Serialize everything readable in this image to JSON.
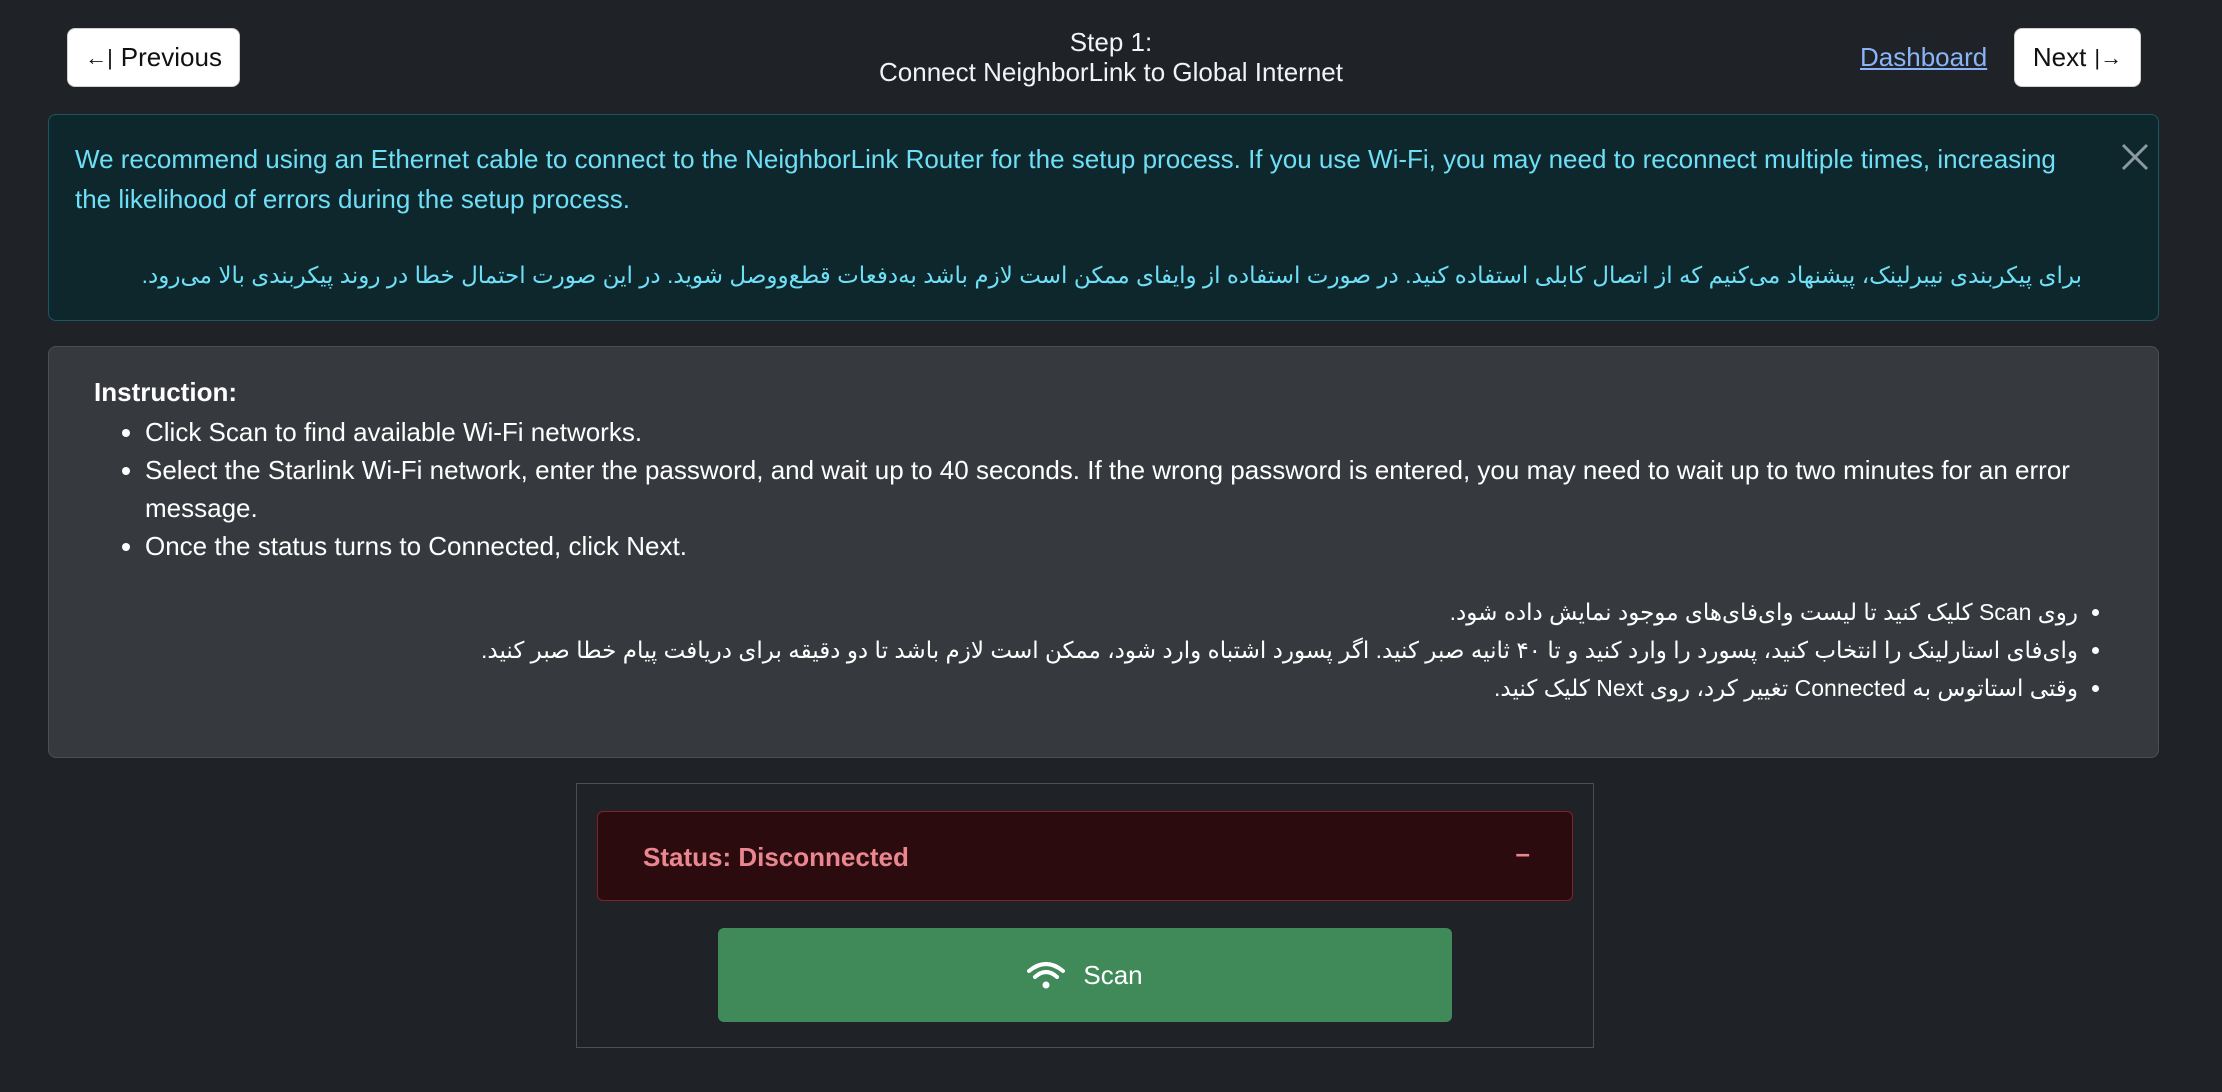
{
  "header": {
    "previous_glyph": "←|",
    "previous_label": "Previous",
    "step_line1": "Step 1:",
    "step_line2": "Connect NeighborLink to Global Internet",
    "dashboard_link": "Dashboard",
    "next_label": "Next",
    "next_glyph": "|→"
  },
  "alert": {
    "text_en": "We recommend using an Ethernet cable to connect to the NeighborLink Router for the setup process. If you use Wi-Fi, you may need to reconnect multiple times, increasing the likelihood of errors during the setup process.",
    "text_fa": "برای پیکربندی نیبرلینک، پیشنهاد می‌کنیم که از اتصال کابلی استفاده کنید. در صورت استفاده از وایفای ممکن است لازم باشد به‌دفعات قطع‌ووصل شوید. در این صورت احتمال خطا در روند پیکربندی بالا می‌رود.",
    "close_icon": "close-icon",
    "color": "#6edff6"
  },
  "instructions": {
    "title": "Instruction:",
    "items_en": [
      "Click Scan to find available Wi-Fi networks.",
      "Select the Starlink Wi-Fi network, enter the password, and wait up to 40 seconds. If the wrong password is entered, you may need to wait up to two minutes for an error message.",
      "Once the status turns to Connected, click Next."
    ],
    "items_fa": [
      "روی Scan کلیک کنید تا لیست وای‌فای‌های موجود نمایش داده شود.",
      "وای‌فای استارلینک را انتخاب کنید، پسورد را وارد کنید و تا ۴۰ ثانیه صبر کنید. اگر پسورد اشتباه وارد شود، ممکن است لازم باشد تا دو دقیقه برای دریافت پیام خطا صبر کنید.",
      "وقتی استاتوس به Connected تغییر کرد، روی Next کلیک کنید."
    ]
  },
  "status": {
    "text": "Status: Disconnected",
    "toggle": "–",
    "color": "#ea868f"
  },
  "scan": {
    "label": "Scan",
    "icon": "wifi-icon",
    "color": "#408a5a"
  }
}
